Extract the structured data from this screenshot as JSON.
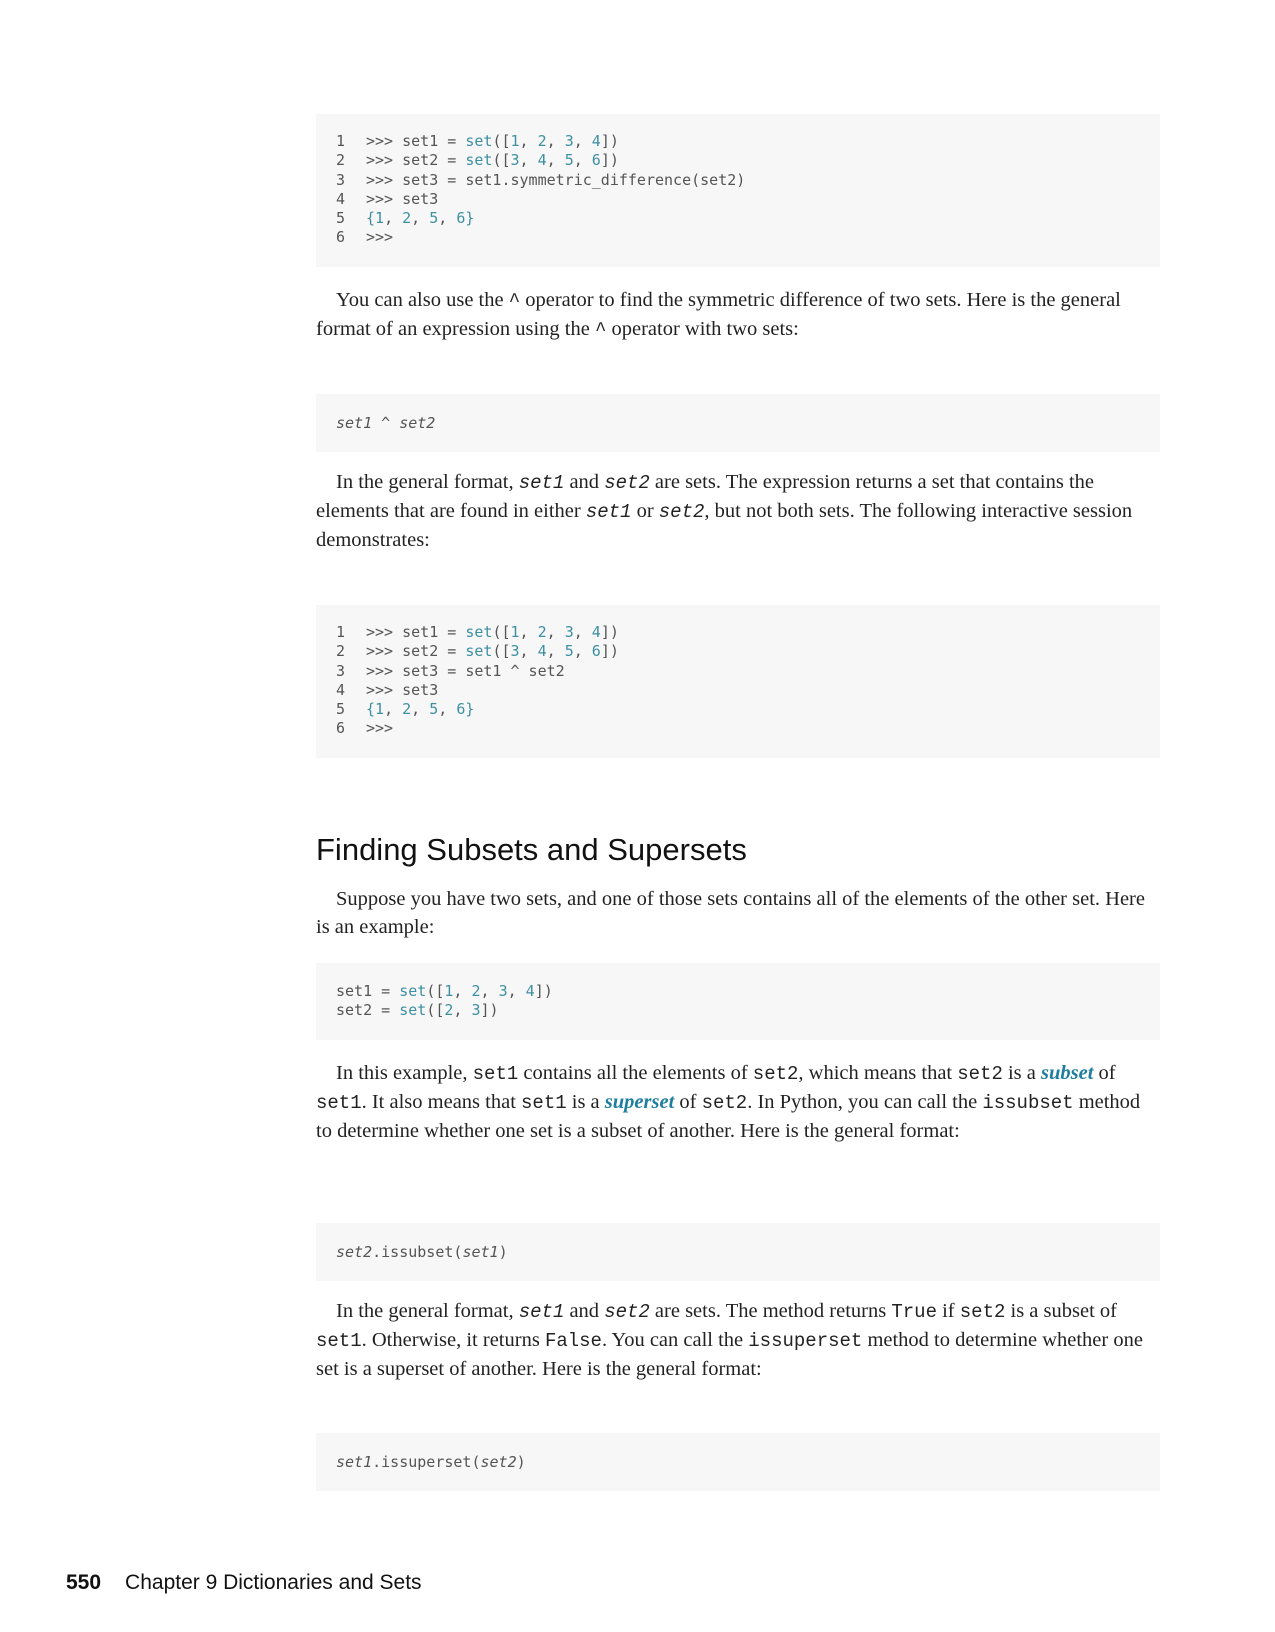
{
  "code_block_1": {
    "line_numbers": [
      "1",
      "2",
      "3",
      "4",
      "5",
      "6"
    ],
    "prompt": ">>> ",
    "line1": {
      "var": "set1 = ",
      "fn": "set",
      "open": "([",
      "n1": "1",
      "n2": "2",
      "n3": "3",
      "n4": "4",
      "close": "])"
    },
    "line2": {
      "var": "set2 = ",
      "fn": "set",
      "open": "([",
      "n1": "3",
      "n2": "4",
      "n3": "5",
      "n4": "6",
      "close": "])"
    },
    "line3": "set3 = set1.symmetric_difference(set2)",
    "line4": "set3",
    "line5": {
      "open": "{",
      "n1": "1",
      "n2": "2",
      "n3": "5",
      "n4": "6",
      "close": "}"
    },
    "line6": ">>>"
  },
  "para_1": {
    "t1": "You can also use the ",
    "op1": "^",
    "t2": " operator to find the symmetric difference of two sets. Here is the general format of an expression using the ",
    "op2": "^",
    "t3": " operator with two sets:"
  },
  "format_1": {
    "a": "set1",
    "op": " ^ ",
    "b": "set2"
  },
  "para_2": {
    "t1": "In the general format, ",
    "c1": "set1",
    "t2": " and ",
    "c2": "set2",
    "t3": " are sets. The expression returns a set that contains the elements that are found in either ",
    "c3": "set1",
    "t4": " or ",
    "c4": "set2",
    "t5": ", but not both sets. The following interactive session demonstrates:"
  },
  "code_block_2": {
    "line3": "set3 = set1 ^ set2"
  },
  "heading": "Finding Subsets and Supersets",
  "para_3": "Suppose you have two sets, and one of those sets contains all of the elements of the other set. Here is an example:",
  "code_block_3": {
    "line1": {
      "var": "set1 = ",
      "fn": "set",
      "open": "([",
      "n1": "1",
      "n2": "2",
      "n3": "3",
      "n4": "4",
      "close": "])"
    },
    "line2": {
      "var": "set2 = ",
      "fn": "set",
      "open": "([",
      "n1": "2",
      "n2": "3",
      "close": "])"
    }
  },
  "para_4": {
    "t1": "In this example, ",
    "c1": "set1",
    "t2": " contains all the elements of ",
    "c2": "set2",
    "t3": ", which means that ",
    "c3": "set2",
    "t4": " is a ",
    "term1": "subset",
    "t5": " of ",
    "c4": "set1",
    "t6": ". It also means that ",
    "c5": "set1",
    "t7": " is a ",
    "term2": "superset",
    "t8": " of ",
    "c6": "set2",
    "t9": ". In Python, you can call the ",
    "c7": "issubset",
    "t10": " method to determine whether one set is a subset of another. Here is the general format:"
  },
  "format_2": {
    "a": "set2",
    "mid": ".issubset(",
    "b": "set1",
    "end": ")"
  },
  "para_5": {
    "t1": "In the general format, ",
    "c1": "set1",
    "t2": " and ",
    "c2": "set2",
    "t3": " are sets. The method returns ",
    "c3": "True",
    "t4": " if ",
    "c4": "set2",
    "t5": " is a subset of ",
    "c5": "set1",
    "t6": ". Otherwise, it returns ",
    "c6": "False",
    "t7": ". You can call the ",
    "c7": "issuperset",
    "t8": " method to determine whether one set is a superset of another. Here is the general format:"
  },
  "format_3": {
    "a": "set1",
    "mid": ".issuperset(",
    "b": "set2",
    "end": ")"
  },
  "footer": {
    "page_number": "550",
    "chapter": "Chapter 9 Dictionaries and Sets"
  },
  "colors": {
    "accent": "#1f7ea0",
    "code_number": "#3d8fa3",
    "code_bg": "#f7f7f7"
  }
}
